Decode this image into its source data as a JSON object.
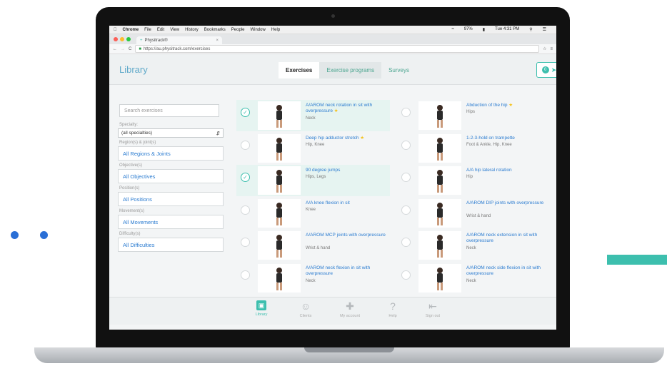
{
  "menubar": {
    "app": "Chrome",
    "items": [
      "File",
      "Edit",
      "View",
      "History",
      "Bookmarks",
      "People",
      "Window",
      "Help"
    ],
    "battery": "97%",
    "clock": "Tue 4:31 PM"
  },
  "browser": {
    "tab_title": "Physitrack®",
    "url": "https://au.physitrack.com/exercises"
  },
  "header": {
    "title": "Library",
    "tabs": [
      {
        "label": "Exercises"
      },
      {
        "label": "Exercise programs"
      },
      {
        "label": "Surveys"
      }
    ],
    "cart_count": "0"
  },
  "filters": {
    "search_placeholder": "Search exercises",
    "specialty_label": "Specialty:",
    "specialty_value": "(all specialties)",
    "regions_label": "Region(s) & joint(s)",
    "regions_value": "All Regions & Joints",
    "objectives_label": "Objective(s)",
    "objectives_value": "All Objectives",
    "positions_label": "Position(s)",
    "positions_value": "All Positions",
    "movements_label": "Movement(s)",
    "movements_value": "All Movements",
    "difficulty_label": "Difficulty(s)",
    "difficulty_value": "All Difficulties"
  },
  "exercises": [
    {
      "name": "A/AROM neck rotation in sit with overpressure",
      "tags": "Neck",
      "starred": true,
      "selected": true
    },
    {
      "name": "Abduction of the hip",
      "tags": "Hips",
      "starred": true,
      "selected": false
    },
    {
      "name": "Deep hip adductor stretch",
      "tags": "Hip, Knee",
      "starred": true,
      "selected": false
    },
    {
      "name": "1-2-3-hold on trampette",
      "tags": "Foot & Ankle, Hip, Knee",
      "starred": false,
      "selected": false
    },
    {
      "name": "90 degree jumps",
      "tags": "Hips, Legs",
      "starred": false,
      "selected": true
    },
    {
      "name": "A/A hip lateral rotation",
      "tags": "Hip",
      "starred": false,
      "selected": false
    },
    {
      "name": "A/A knee flexion in sit",
      "tags": "Knee",
      "starred": false,
      "selected": false
    },
    {
      "name": "A/AROM DIP joints with overpressure",
      "tags": "Wrist & hand",
      "starred": false,
      "selected": false
    },
    {
      "name": "A/AROM MCP joints with overpressure",
      "tags": "Wrist & hand",
      "starred": false,
      "selected": false
    },
    {
      "name": "A/AROM neck extension in sit with overpressure",
      "tags": "Neck",
      "starred": false,
      "selected": false
    },
    {
      "name": "A/AROM neck flexion in sit with overpressure",
      "tags": "Neck",
      "starred": false,
      "selected": false
    },
    {
      "name": "A/AROM neck side flexion in sit with overpressure",
      "tags": "Neck",
      "starred": false,
      "selected": false
    }
  ],
  "bottom_nav": [
    {
      "label": "Library",
      "icon": "library-icon"
    },
    {
      "label": "Clients",
      "icon": "clients-icon"
    },
    {
      "label": "My account",
      "icon": "account-icon"
    },
    {
      "label": "Help",
      "icon": "help-icon"
    },
    {
      "label": "Sign out",
      "icon": "sign-out-icon"
    }
  ],
  "colors": {
    "accent": "#3dbfae",
    "link": "#2a7bd0",
    "star": "#f4c21c",
    "deco_dots": "#2a6fd6"
  }
}
